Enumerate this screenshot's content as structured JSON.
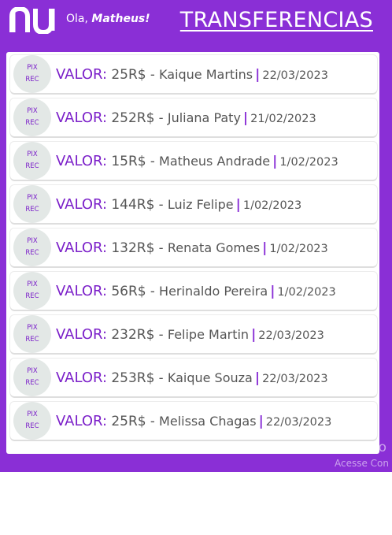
{
  "header": {
    "greeting_prefix": "Ola,",
    "user_name": "Matheus!",
    "title": "TRANSFERENCIAS"
  },
  "colors": {
    "brand": "#8a2fd6",
    "accent_text": "#7b1fc9",
    "badge_bg": "#e3e8e6"
  },
  "transfers": [
    {
      "badge_top": "PIX",
      "badge_bottom": "REC",
      "label": "VALOR:",
      "amount": "25R$",
      "separator": "-",
      "name": "Kaique Martins",
      "date": "22/03/2023"
    },
    {
      "badge_top": "PIX",
      "badge_bottom": "REC",
      "label": "VALOR:",
      "amount": "252R$",
      "separator": "-",
      "name": "Juliana Paty",
      "date": "21/02/2023"
    },
    {
      "badge_top": "PIX",
      "badge_bottom": "REC",
      "label": "VALOR:",
      "amount": "15R$",
      "separator": "-",
      "name": "Matheus Andrade",
      "date": "1/02/2023"
    },
    {
      "badge_top": "PIX",
      "badge_bottom": "REC",
      "label": "VALOR:",
      "amount": "144R$",
      "separator": "-",
      "name": "Luiz Felipe",
      "date": "1/02/2023"
    },
    {
      "badge_top": "PIX",
      "badge_bottom": "REC",
      "label": "VALOR:",
      "amount": "132R$",
      "separator": "-",
      "name": "Renata Gomes",
      "date": "1/02/2023"
    },
    {
      "badge_top": "PIX",
      "badge_bottom": "REC",
      "label": "VALOR:",
      "amount": "56R$",
      "separator": "-",
      "name": "Herinaldo Pereira",
      "date": "1/02/2023"
    },
    {
      "badge_top": "PIX",
      "badge_bottom": "REC",
      "label": "VALOR:",
      "amount": "232R$",
      "separator": "-",
      "name": "Felipe Martin",
      "date": "22/03/2023"
    },
    {
      "badge_top": "PIX",
      "badge_bottom": "REC",
      "label": "VALOR:",
      "amount": "253R$",
      "separator": "-",
      "name": "Kaique Souza",
      "date": "22/03/2023"
    },
    {
      "badge_top": "PIX",
      "badge_bottom": "REC",
      "label": "VALOR:",
      "amount": "25R$",
      "separator": "-",
      "name": "Melissa Chagas",
      "date": "22/03/2023"
    }
  ],
  "row_separator": "|",
  "watermark": {
    "line1": "Ativar o",
    "line2": "Acesse Con"
  }
}
